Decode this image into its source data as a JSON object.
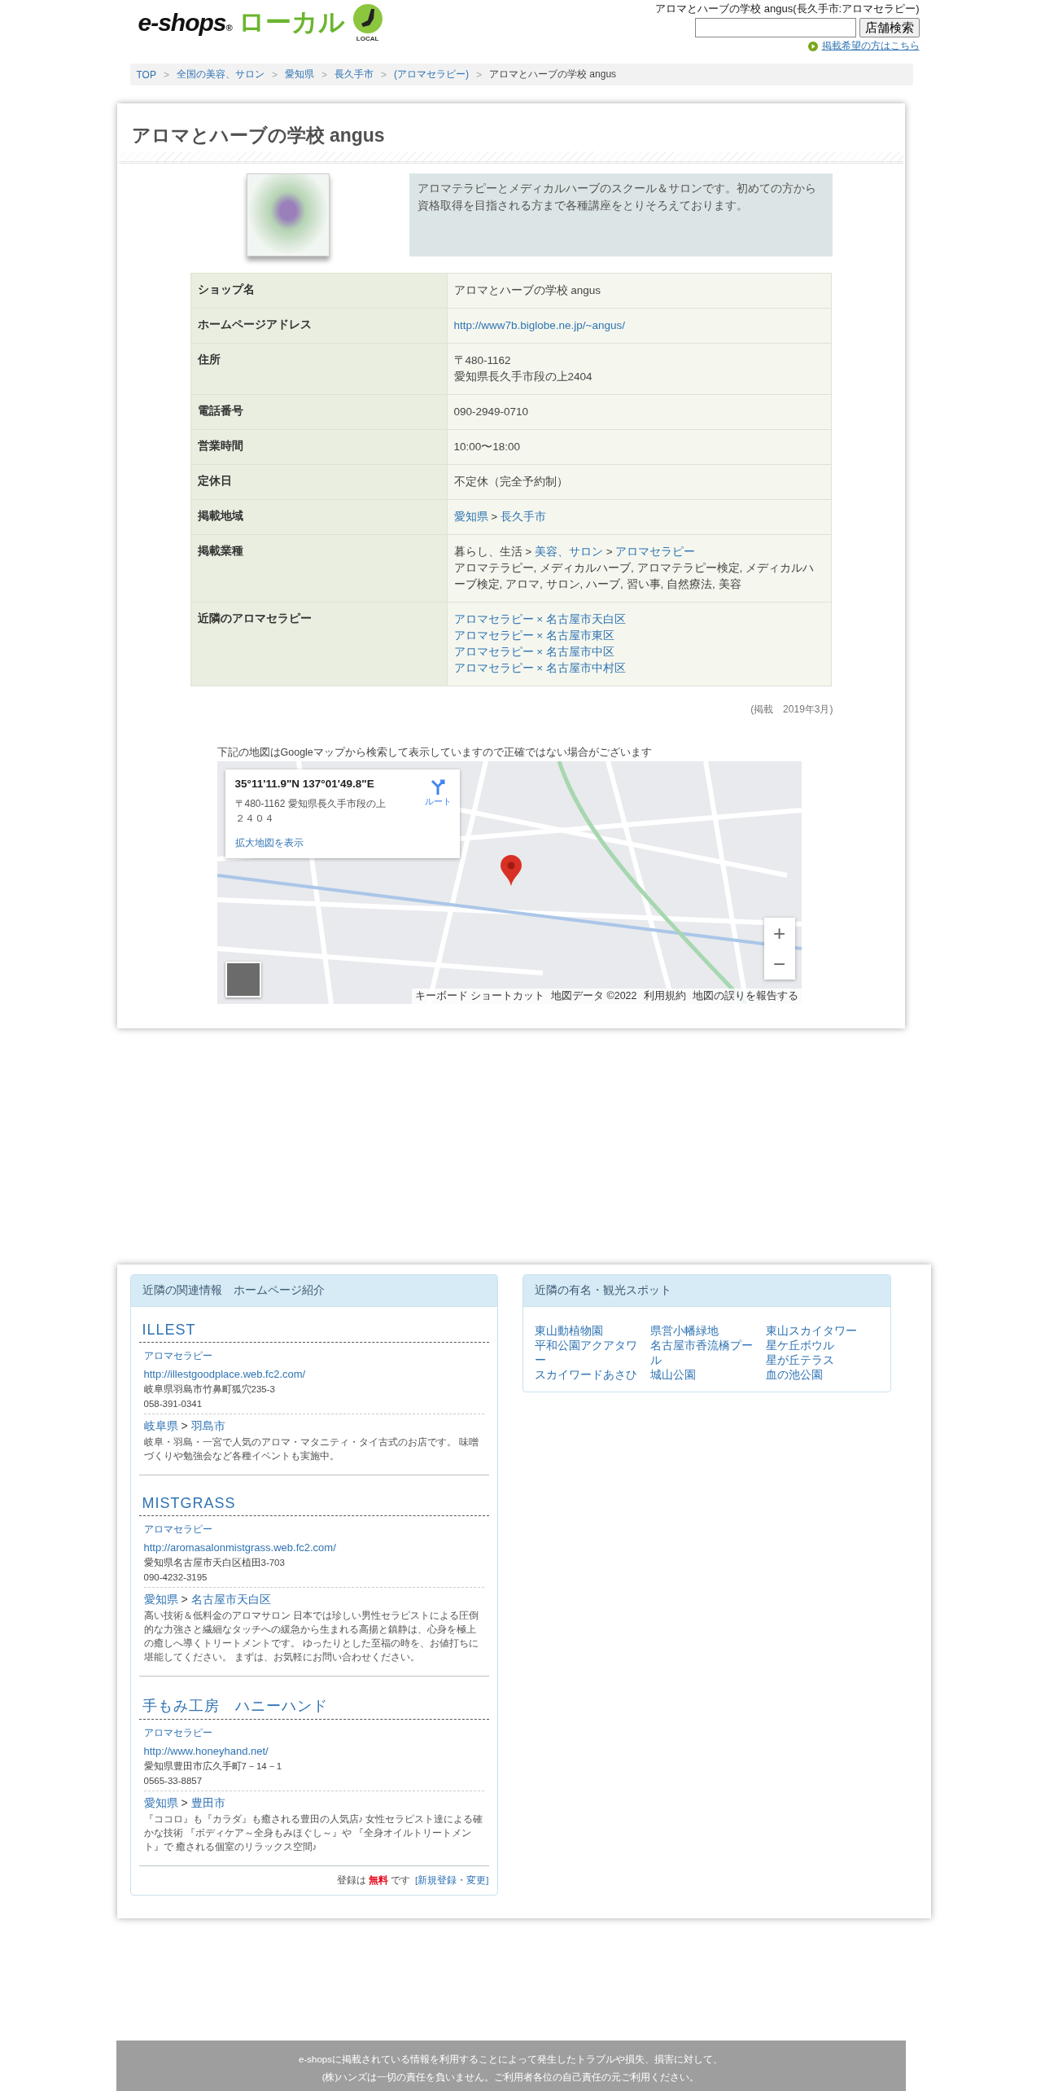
{
  "header": {
    "logo": {
      "brand": "e-shops",
      "mark": "®",
      "local_jp": "ローカル",
      "local_en": "LOCAL"
    },
    "page_title": "アロマとハーブの学校 angus(長久手市:アロマセラピー)",
    "search": {
      "button": "店舗検索"
    },
    "listing_link": "掲載希望の方はこちら"
  },
  "breadcrumb": [
    {
      "label": "TOP",
      "current": false
    },
    {
      "separator": ">",
      "label": "全国の美容、サロン",
      "current": false
    },
    {
      "separator": ">",
      "label": "愛知県",
      "current": false
    },
    {
      "separator": ">",
      "label": "長久手市",
      "current": false
    },
    {
      "separator": ">",
      "label": "(アロマセラピー)",
      "current": false
    },
    {
      "separator": ">",
      "label": "アロマとハーブの学校 angus",
      "current": true
    }
  ],
  "shop": {
    "title": "アロマとハーブの学校 angus",
    "description": "アロマテラピーとメディカルハーブのスクール＆サロンです。初めての方から資格取得を目指される方まで各種講座をとりそろえております。",
    "details": [
      {
        "label": "ショップ名",
        "lines": [
          [
            {
              "text": "アロマとハーブの学校 angus",
              "link": false
            }
          ]
        ]
      },
      {
        "label": "ホームページアドレス",
        "lines": [
          [
            {
              "text": "http://www7b.biglobe.ne.jp/~angus/",
              "link": true
            }
          ]
        ]
      },
      {
        "label": "住所",
        "lines": [
          [
            {
              "text": "〒480-1162",
              "link": false
            }
          ],
          [
            {
              "text": "愛知県長久手市段の上2404",
              "link": false
            }
          ]
        ]
      },
      {
        "label": "電話番号",
        "lines": [
          [
            {
              "text": "090-2949-0710",
              "link": false
            }
          ]
        ]
      },
      {
        "label": "営業時間",
        "lines": [
          [
            {
              "text": "10:00〜18:00",
              "link": false
            }
          ]
        ]
      },
      {
        "label": "定休日",
        "lines": [
          [
            {
              "text": "不定休（完全予約制）",
              "link": false
            }
          ]
        ]
      },
      {
        "label": "掲載地域",
        "lines": [
          [
            {
              "text": "愛知県",
              "link": true
            },
            {
              "text": " > ",
              "link": false
            },
            {
              "text": "長久手市",
              "link": true
            }
          ]
        ]
      },
      {
        "label": "掲載業種",
        "lines": [
          [
            {
              "text": "暮らし、生活 > ",
              "link": false
            },
            {
              "text": "美容、サロン",
              "link": true
            },
            {
              "text": " > ",
              "link": false
            },
            {
              "text": "アロマセラピー",
              "link": true
            }
          ],
          [
            {
              "text": "アロマテラピー, メディカルハーブ, アロマテラピー検定, メディカルハーブ検定, アロマ, サロン, ハーブ, 習い事, 自然療法, 美容",
              "link": false
            }
          ]
        ]
      },
      {
        "label": "近隣のアロマセラピー",
        "lines": [
          [
            {
              "text": "アロマセラピー × 名古屋市天白区",
              "link": true
            }
          ],
          [
            {
              "text": "アロマセラピー × 名古屋市東区",
              "link": true
            }
          ],
          [
            {
              "text": "アロマセラピー × 名古屋市中区",
              "link": true
            }
          ],
          [
            {
              "text": "アロマセラピー × 名古屋市中村区",
              "link": true
            }
          ]
        ]
      }
    ],
    "posted": "(掲載　2019年3月)"
  },
  "map": {
    "note": "下記の地図はGoogleマップから検索して表示していますので正確ではない場合がございます",
    "coordinates": "35°11'11.9\"N 137°01'49.8\"E",
    "address": "〒480-1162 愛知県長久手市段の上２４０４",
    "route": "ルート",
    "enlarge": "拡大地図を表示",
    "zoom_in": "+",
    "zoom_out": "−",
    "attribution": [
      "キーボード ショートカット",
      "地図データ ©2022",
      "利用規約",
      "地図の誤りを報告する"
    ]
  },
  "nearby_sites": {
    "title": "近隣の関連情報　ホームページ紹介",
    "entries": [
      {
        "name": "ILLEST",
        "category": "アロマセラピー",
        "url": "http://illestgoodplace.web.fc2.com/",
        "address": "岐阜県羽島市竹鼻町狐穴235-3",
        "phone": "058-391-0341",
        "prefecture": "岐阜県",
        "area_separator": ">",
        "city": "羽島市",
        "description": "岐阜・羽島・一宮で人気のアロマ・マタニティ・タイ古式のお店です。 味噌づくりや勉強会など各種イベントも実施中。"
      },
      {
        "name": "MISTGRASS",
        "category": "アロマセラピー",
        "url": "http://aromasalonmistgrass.web.fc2.com/",
        "address": "愛知県名古屋市天白区植田3-703",
        "phone": "090-4232-3195",
        "prefecture": "愛知県",
        "area_separator": ">",
        "city": "名古屋市天白区",
        "description": "高い技術＆低料金のアロマサロン 日本では珍しい男性セラピストによる圧倒的な力強さと繊細なタッチへの緩急から生まれる高揚と鎮静は、心身を極上の癒しへ導くトリートメントです。 ゆったりとした至福の時を、お値打ちに堪能してください。 まずは、お気軽にお問い合わせください。"
      },
      {
        "name": "手もみ工房　ハニーハンド",
        "category": "アロマセラピー",
        "url": "http://www.honeyhand.net/",
        "address": "愛知県豊田市広久手町7－14－1",
        "phone": "0565-33-8857",
        "prefecture": "愛知県",
        "area_separator": ">",
        "city": "豊田市",
        "description": "『ココロ』も『カラダ』も癒される豊田の人気店♪ 女性セラピスト達による確かな技術 『ボディケア～全身もみほぐし～』や 『全身オイルトリートメント』で 癒される個室のリラックス空間♪"
      }
    ],
    "register": {
      "before": "登録は",
      "free": "無料",
      "after": "です",
      "link": "[新規登録・変更]"
    }
  },
  "spots": {
    "title": "近隣の有名・観光スポット",
    "columns": [
      [
        "東山動植物園",
        "平和公園アクアタワー",
        "スカイワードあさひ"
      ],
      [
        "県営小幡緑地",
        "名古屋市香流橋プール",
        "城山公園"
      ],
      [
        "東山スカイタワー",
        "星ケ丘ボウル",
        "星が丘テラス",
        "血の池公園"
      ]
    ]
  },
  "footer": [
    "e-shopsに掲載されている情報を利用することによって発生したトラブルや損失、損害に対して、",
    "(株)ハンズは一切の責任を負いません。ご利用者各位の自己責任の元ご利用ください。"
  ]
}
